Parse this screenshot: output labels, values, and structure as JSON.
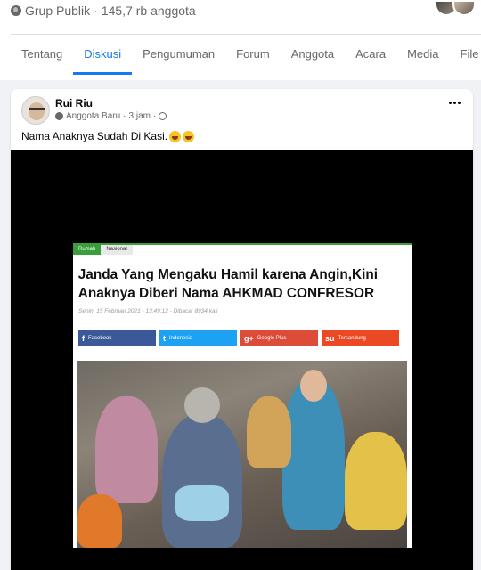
{
  "group": {
    "privacy": "Grup Publik",
    "separator": "·",
    "members": "145,7 rb anggota"
  },
  "tabs": [
    {
      "label": "Tentang",
      "active": false
    },
    {
      "label": "Diskusi",
      "active": true
    },
    {
      "label": "Pengumuman",
      "active": false
    },
    {
      "label": "Forum",
      "active": false
    },
    {
      "label": "Anggota",
      "active": false
    },
    {
      "label": "Acara",
      "active": false
    },
    {
      "label": "Media",
      "active": false
    },
    {
      "label": "File",
      "active": false
    }
  ],
  "post": {
    "author": "Rui Riu",
    "role": "Anggota Baru",
    "time": "3 jam",
    "dot": "·",
    "text": "Nama Anaknya Sudah Di Kasi."
  },
  "article": {
    "crumbs": [
      "Rumah",
      "Nasional"
    ],
    "headline_1": "Janda Yang Mengaku Hamil karena Angin,Kini",
    "headline_2": "Anaknya Diberi Nama AHKMAD CONFRESOR",
    "dateline": "Senin, 15 Februari 2021 - 13:49:12 - Dibaca: 8934 kali",
    "share": [
      {
        "label": "Facebook",
        "icon": "f"
      },
      {
        "label": "Indonesia",
        "icon": "t"
      },
      {
        "label": "Google Plus",
        "icon": "g+"
      },
      {
        "label": "Tersandung",
        "icon": "su"
      }
    ]
  },
  "colors": {
    "accent": "#1877f2",
    "facebook": "#3b5998",
    "twitter": "#1da1f2",
    "google": "#dd4b39",
    "stumble": "#eb4924"
  },
  "icons": [
    "globe-icon",
    "more-icon",
    "member-badge-icon",
    "audience-globe-icon",
    "laughing-emoji-icon"
  ]
}
